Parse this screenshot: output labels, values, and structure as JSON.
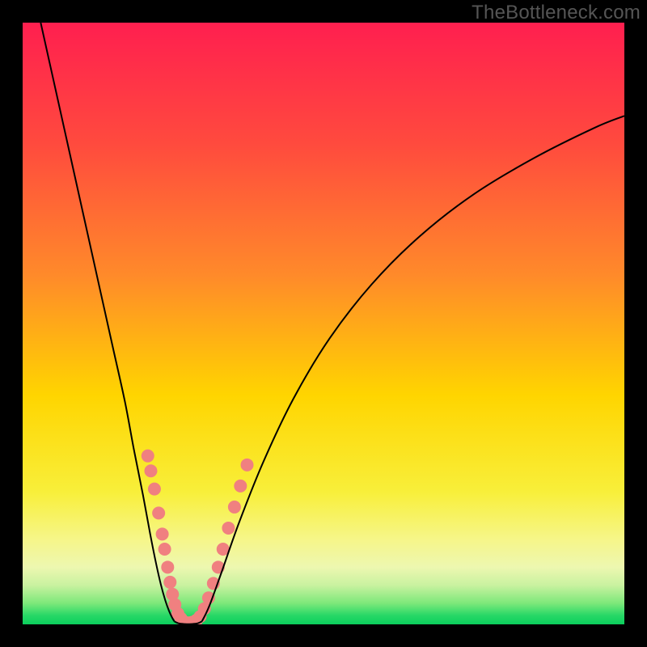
{
  "watermark": "TheBottleneck.com",
  "chart_data": {
    "type": "line",
    "title": "",
    "xlabel": "",
    "ylabel": "",
    "xlim": [
      0,
      100
    ],
    "ylim": [
      0,
      100
    ],
    "grid": false,
    "legend": false,
    "background_gradient_stops": [
      {
        "offset": 0.0,
        "color": "#ff1f4f"
      },
      {
        "offset": 0.2,
        "color": "#ff4a3e"
      },
      {
        "offset": 0.42,
        "color": "#ff8a2a"
      },
      {
        "offset": 0.62,
        "color": "#ffd500"
      },
      {
        "offset": 0.78,
        "color": "#f8ef3a"
      },
      {
        "offset": 0.86,
        "color": "#f6f68a"
      },
      {
        "offset": 0.905,
        "color": "#edf7b0"
      },
      {
        "offset": 0.935,
        "color": "#c9f2a0"
      },
      {
        "offset": 0.965,
        "color": "#7de87a"
      },
      {
        "offset": 0.985,
        "color": "#28d867"
      },
      {
        "offset": 1.0,
        "color": "#0bce5c"
      }
    ],
    "series": [
      {
        "name": "left-curve",
        "color": "#000000",
        "width": 2,
        "x": [
          3.0,
          5.0,
          7.0,
          9.0,
          11.0,
          13.0,
          15.0,
          17.0,
          18.5,
          20.0,
          21.2,
          22.2,
          23.0,
          23.7,
          24.3,
          24.8,
          25.2
        ],
        "y": [
          100.0,
          91.0,
          82.0,
          73.0,
          64.0,
          55.0,
          46.0,
          37.0,
          29.0,
          21.5,
          15.0,
          10.0,
          6.5,
          4.0,
          2.3,
          1.2,
          0.5
        ]
      },
      {
        "name": "valley-floor",
        "color": "#000000",
        "width": 2,
        "x": [
          25.2,
          26.0,
          27.0,
          28.0,
          29.0,
          29.8
        ],
        "y": [
          0.5,
          0.15,
          0.05,
          0.05,
          0.15,
          0.5
        ]
      },
      {
        "name": "right-curve",
        "color": "#000000",
        "width": 2,
        "x": [
          29.8,
          31.0,
          33.0,
          36.0,
          40.0,
          45.0,
          51.0,
          58.0,
          66.0,
          75.0,
          85.0,
          95.0,
          100.0
        ],
        "y": [
          0.5,
          3.0,
          8.5,
          17.0,
          27.0,
          37.5,
          47.5,
          56.5,
          64.5,
          71.5,
          77.5,
          82.5,
          84.5
        ]
      }
    ],
    "markers": [
      {
        "name": "left-branch-markers",
        "color": "#f08080",
        "radius": 8,
        "points": [
          {
            "x": 20.8,
            "y": 28.0
          },
          {
            "x": 21.3,
            "y": 25.5
          },
          {
            "x": 21.9,
            "y": 22.5
          },
          {
            "x": 22.6,
            "y": 18.5
          },
          {
            "x": 23.2,
            "y": 15.0
          },
          {
            "x": 23.6,
            "y": 12.5
          },
          {
            "x": 24.1,
            "y": 9.5
          },
          {
            "x": 24.5,
            "y": 7.0
          },
          {
            "x": 24.9,
            "y": 5.0
          },
          {
            "x": 25.3,
            "y": 3.3
          },
          {
            "x": 25.8,
            "y": 1.8
          },
          {
            "x": 26.3,
            "y": 1.0
          }
        ]
      },
      {
        "name": "valley-markers",
        "color": "#f08080",
        "radius": 8,
        "points": [
          {
            "x": 26.8,
            "y": 0.45
          },
          {
            "x": 27.5,
            "y": 0.25
          },
          {
            "x": 28.2,
            "y": 0.35
          },
          {
            "x": 28.9,
            "y": 0.7
          }
        ]
      },
      {
        "name": "right-branch-markers",
        "color": "#f08080",
        "radius": 8,
        "points": [
          {
            "x": 29.5,
            "y": 1.3
          },
          {
            "x": 30.2,
            "y": 2.6
          },
          {
            "x": 30.9,
            "y": 4.4
          },
          {
            "x": 31.7,
            "y": 6.8
          },
          {
            "x": 32.5,
            "y": 9.5
          },
          {
            "x": 33.3,
            "y": 12.5
          },
          {
            "x": 34.2,
            "y": 16.0
          },
          {
            "x": 35.2,
            "y": 19.5
          },
          {
            "x": 36.2,
            "y": 23.0
          },
          {
            "x": 37.3,
            "y": 26.5
          }
        ]
      }
    ]
  }
}
